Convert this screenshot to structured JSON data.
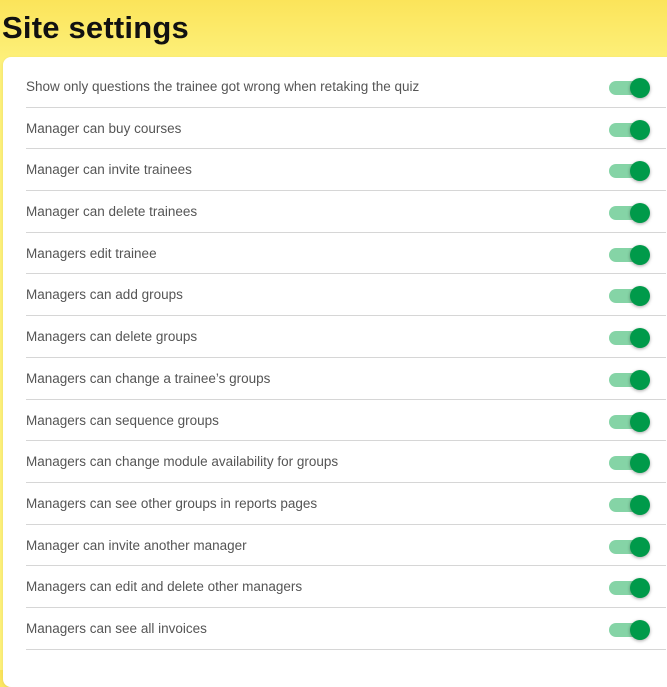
{
  "header": {
    "title": "Site settings"
  },
  "colors": {
    "header_background": "#fbe45a",
    "toggle_on_thumb": "#009a4a",
    "toggle_on_track": "#85d4a6"
  },
  "settings": [
    {
      "label": "Show only questions the trainee got wrong when retaking the quiz",
      "enabled": true
    },
    {
      "label": "Manager can buy courses",
      "enabled": true
    },
    {
      "label": "Manager can invite trainees",
      "enabled": true
    },
    {
      "label": "Manager can delete trainees",
      "enabled": true
    },
    {
      "label": "Managers edit trainee",
      "enabled": true
    },
    {
      "label": "Managers can add groups",
      "enabled": true
    },
    {
      "label": "Managers can delete groups",
      "enabled": true
    },
    {
      "label": "Managers can change a trainee’s groups",
      "enabled": true
    },
    {
      "label": "Managers can sequence groups",
      "enabled": true
    },
    {
      "label": "Managers can change module availability for groups",
      "enabled": true
    },
    {
      "label": "Managers can see other groups in reports pages",
      "enabled": true
    },
    {
      "label": "Manager can invite another manager",
      "enabled": true
    },
    {
      "label": "Managers can edit and delete other managers",
      "enabled": true
    },
    {
      "label": "Managers can see all invoices",
      "enabled": true
    }
  ]
}
